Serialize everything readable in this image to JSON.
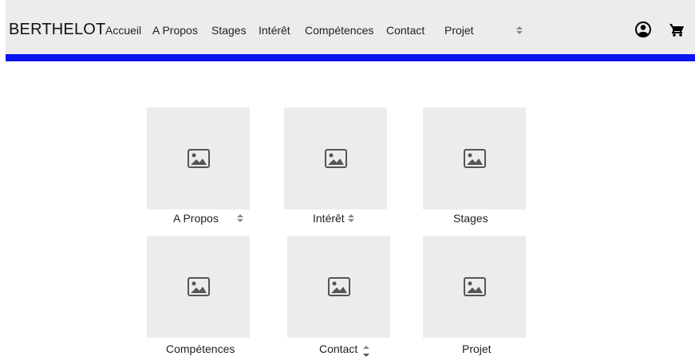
{
  "header": {
    "brand": "BERTHELOT",
    "nav": [
      {
        "label": "Accueil"
      },
      {
        "label": "A Propos"
      },
      {
        "label": "Stages"
      },
      {
        "label": "Intérêt"
      },
      {
        "label": "Compétences"
      },
      {
        "label": "Contact"
      },
      {
        "label": "Projet"
      }
    ],
    "icons": {
      "account": "user-circle-icon",
      "cart": "cart-icon"
    },
    "accent_color": "#0a14f0"
  },
  "gallery": {
    "cards": [
      {
        "caption": "A Propos"
      },
      {
        "caption": "Intérêt"
      },
      {
        "caption": "Stages"
      },
      {
        "caption": "Compétences"
      },
      {
        "caption": "Contact"
      },
      {
        "caption": "Projet"
      }
    ]
  }
}
